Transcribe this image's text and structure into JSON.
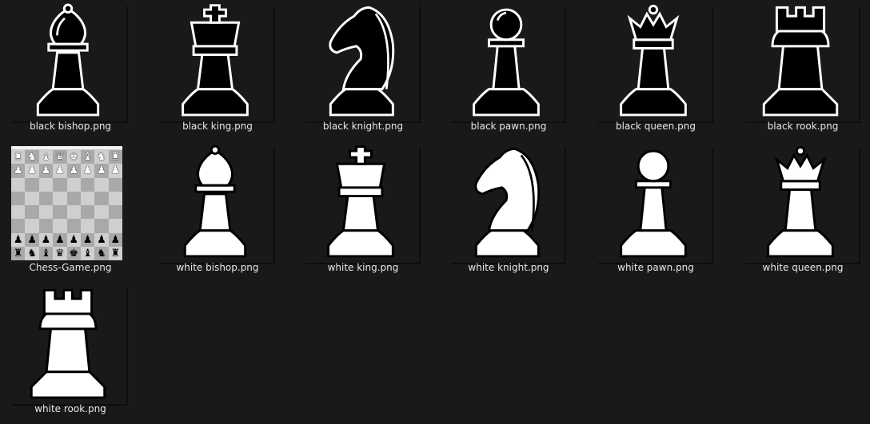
{
  "files": [
    {
      "name": "black bishop.png",
      "icon": "black-bishop-icon"
    },
    {
      "name": "black king.png",
      "icon": "black-king-icon"
    },
    {
      "name": "black knight.png",
      "icon": "black-knight-icon"
    },
    {
      "name": "black pawn.png",
      "icon": "black-pawn-icon"
    },
    {
      "name": "black queen.png",
      "icon": "black-queen-icon"
    },
    {
      "name": "black rook.png",
      "icon": "black-rook-icon"
    },
    {
      "name": "Chess-Game.png",
      "icon": "chess-board-thumbnail"
    },
    {
      "name": "white bishop.png",
      "icon": "white-bishop-icon"
    },
    {
      "name": "white king.png",
      "icon": "white-king-icon"
    },
    {
      "name": "white knight.png",
      "icon": "white-knight-icon"
    },
    {
      "name": "white pawn.png",
      "icon": "white-pawn-icon"
    },
    {
      "name": "white queen.png",
      "icon": "white-queen-icon"
    },
    {
      "name": "white rook.png",
      "icon": "white-rook-icon"
    }
  ],
  "colors": {
    "background": "#191919",
    "label_text": "#e6e6e6"
  }
}
